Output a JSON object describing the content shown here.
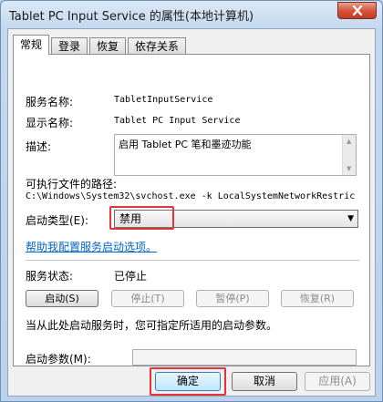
{
  "window": {
    "title": "Tablet PC Input Service 的属性(本地计算机)",
    "close_icon": "close-icon"
  },
  "tabs": [
    {
      "label": "常规"
    },
    {
      "label": "登录"
    },
    {
      "label": "恢复"
    },
    {
      "label": "依存关系"
    }
  ],
  "general": {
    "service_name_label": "服务名称:",
    "service_name_value": "TabletInputService",
    "display_name_label": "显示名称:",
    "display_name_value": "Tablet PC Input Service",
    "description_label": "描述:",
    "description_value": "启用 Tablet PC 笔和墨迹功能",
    "exe_path_label": "可执行文件的路径:",
    "exe_path_value": "C:\\Windows\\System32\\svchost.exe -k LocalSystemNetworkRestric",
    "startup_type_label": "启动类型(E):",
    "startup_type_value": "禁用",
    "help_link": "帮助我配置服务启动选项。",
    "status_label": "服务状态:",
    "status_value": "已停止",
    "buttons": {
      "start": "启动(S)",
      "stop": "停止(T)",
      "pause": "暂停(P)",
      "resume": "恢复(R)"
    },
    "hint": "当从此处启动服务时，您可指定所适用的启动参数。",
    "start_params_label": "启动参数(M):",
    "start_params_value": ""
  },
  "dialog_buttons": {
    "ok": "确定",
    "cancel": "取消",
    "apply": "应用(A)"
  },
  "colors": {
    "highlight": "#e5333a",
    "link": "#0066cc"
  }
}
